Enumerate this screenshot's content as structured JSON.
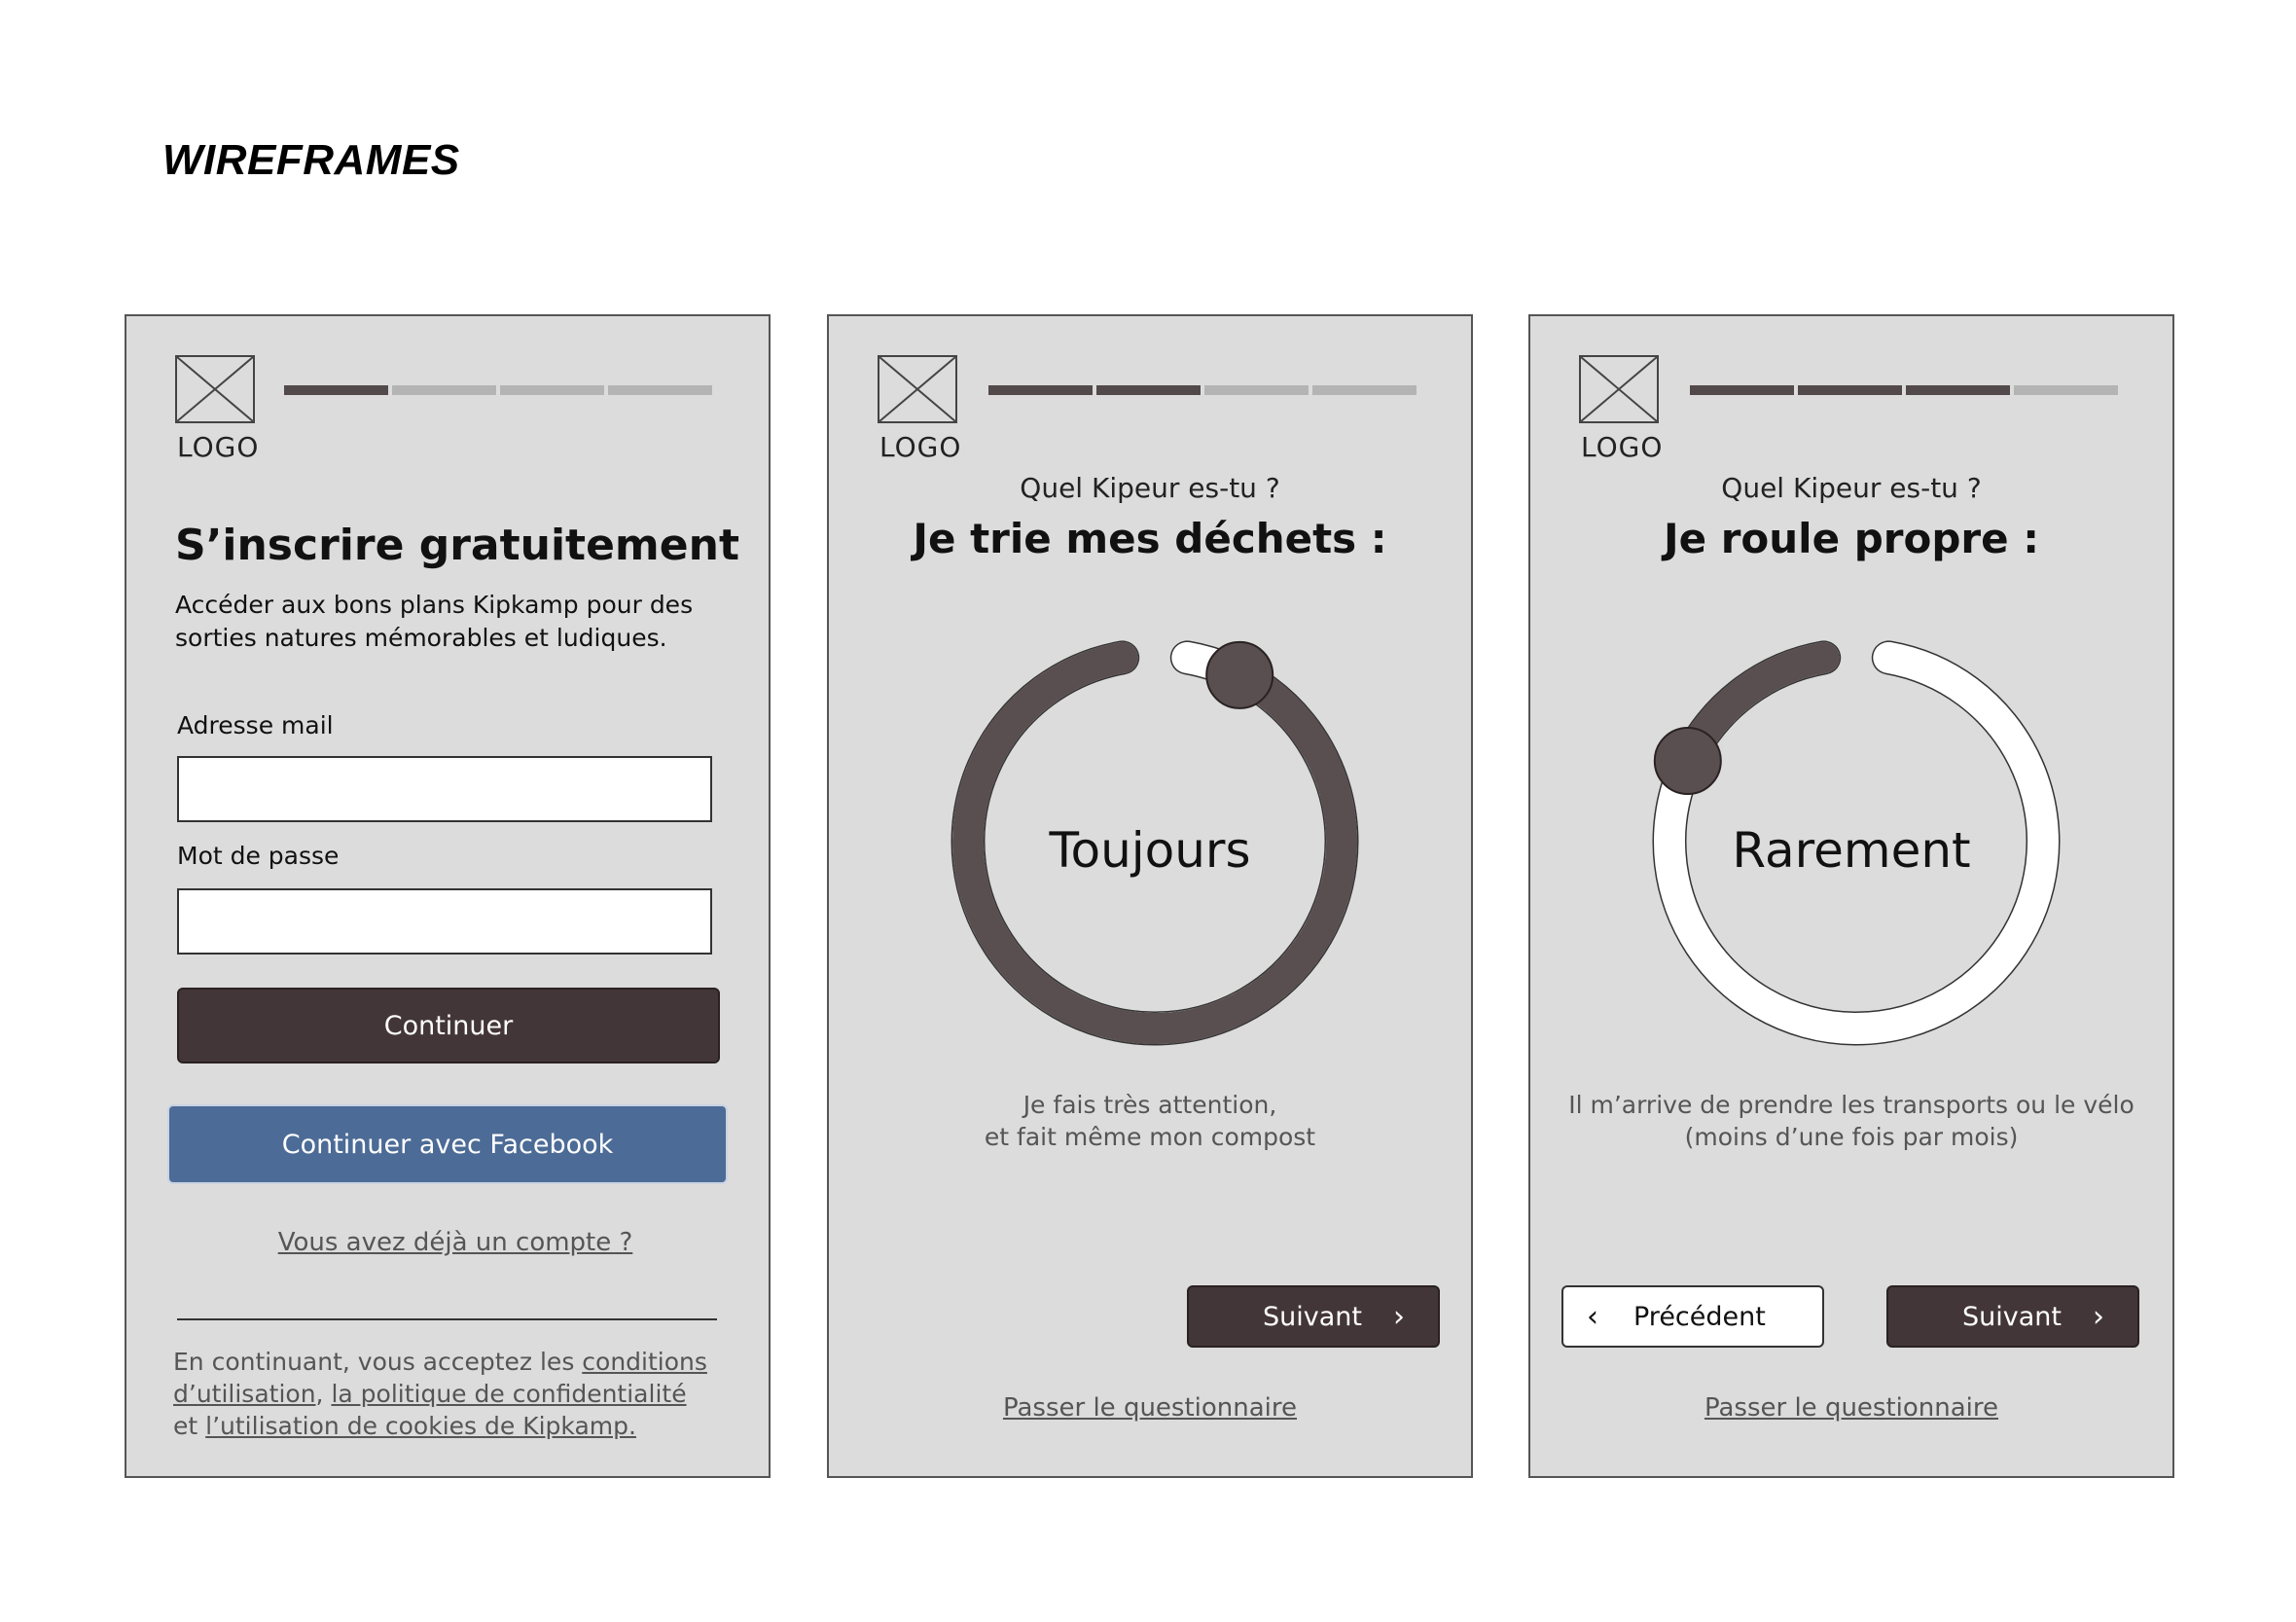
{
  "page_title": "WIREFRAMES",
  "logo_label": "LOGO",
  "screens": [
    {
      "progress": [
        true,
        false,
        false,
        false
      ],
      "title": "S’inscrire gratuitement",
      "description": "Accéder aux bons plans Kipkamp pour des sorties natures mémorables et ludiques.",
      "email_label": "Adresse mail",
      "email_value": "",
      "password_label": "Mot de passe",
      "password_value": "",
      "continue_label": "Continuer",
      "facebook_label": "Continuer avec Facebook",
      "login_link": "Vous avez déjà un compte ?",
      "legal_prefix": "En continuant, vous acceptez les ",
      "legal_terms": "conditions d’utilisation",
      "legal_sep": ", ",
      "legal_privacy": "la politique de confidentialité",
      "legal_and": " et ",
      "legal_cookies": "l’utilisation de cookies de Kipkamp."
    },
    {
      "progress": [
        true,
        true,
        false,
        false
      ],
      "question": "Quel Kipeur es-tu ?",
      "headline": "Je trie mes déchets :",
      "dial_label": "Toujours",
      "dial_value": 0.95,
      "caption_line1": "Je fais très attention,",
      "caption_line2": "et fait même mon compost",
      "next_label": "Suivant",
      "skip_link": "Passer le questionnaire"
    },
    {
      "progress": [
        true,
        true,
        true,
        false
      ],
      "question": "Quel Kipeur es-tu ?",
      "headline": "Je roule propre :",
      "dial_label": "Rarement",
      "dial_value": 0.16,
      "caption_line1": "Il m’arrive de prendre les transports ou le vélo",
      "caption_line2": "(moins d’une fois par mois)",
      "prev_label": "Précédent",
      "next_label": "Suivant",
      "skip_link": "Passer le questionnaire"
    }
  ],
  "colors": {
    "frame_bg": "#dcdcdc",
    "dark": "#433638",
    "facebook": "#4c6b96",
    "progress_on": "#524a4a",
    "progress_off": "#b4b4b4"
  }
}
